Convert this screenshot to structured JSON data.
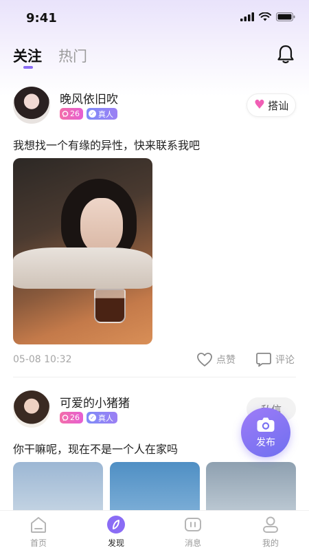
{
  "status_bar": {
    "time": "9:41"
  },
  "nav": {
    "tabs": [
      "关注",
      "热门"
    ],
    "active_tab": "关注"
  },
  "posts": [
    {
      "username": "晚风依旧吹",
      "level": "26",
      "verified_label": "真人",
      "action_label": "搭讪",
      "text": "我想找一个有缘的异性，快来联系我吧",
      "time": "05-08 10:32",
      "like_label": "点赞",
      "comment_label": "评论"
    },
    {
      "username": "可爱的小猪猪",
      "level": "26",
      "verified_label": "真人",
      "action_label": "私信",
      "text": "你干嘛呢，现在不是一个人在家吗"
    }
  ],
  "fab": {
    "label": "发布"
  },
  "tabbar": [
    {
      "label": "首页",
      "icon": "home-icon"
    },
    {
      "label": "发现",
      "icon": "discover-icon",
      "active": true
    },
    {
      "label": "消息",
      "icon": "message-icon"
    },
    {
      "label": "我的",
      "icon": "profile-icon"
    }
  ],
  "colors": {
    "accent": "#8a6cf5",
    "pink": "#f05fb5",
    "gradient_top": "#e9e3fb"
  }
}
